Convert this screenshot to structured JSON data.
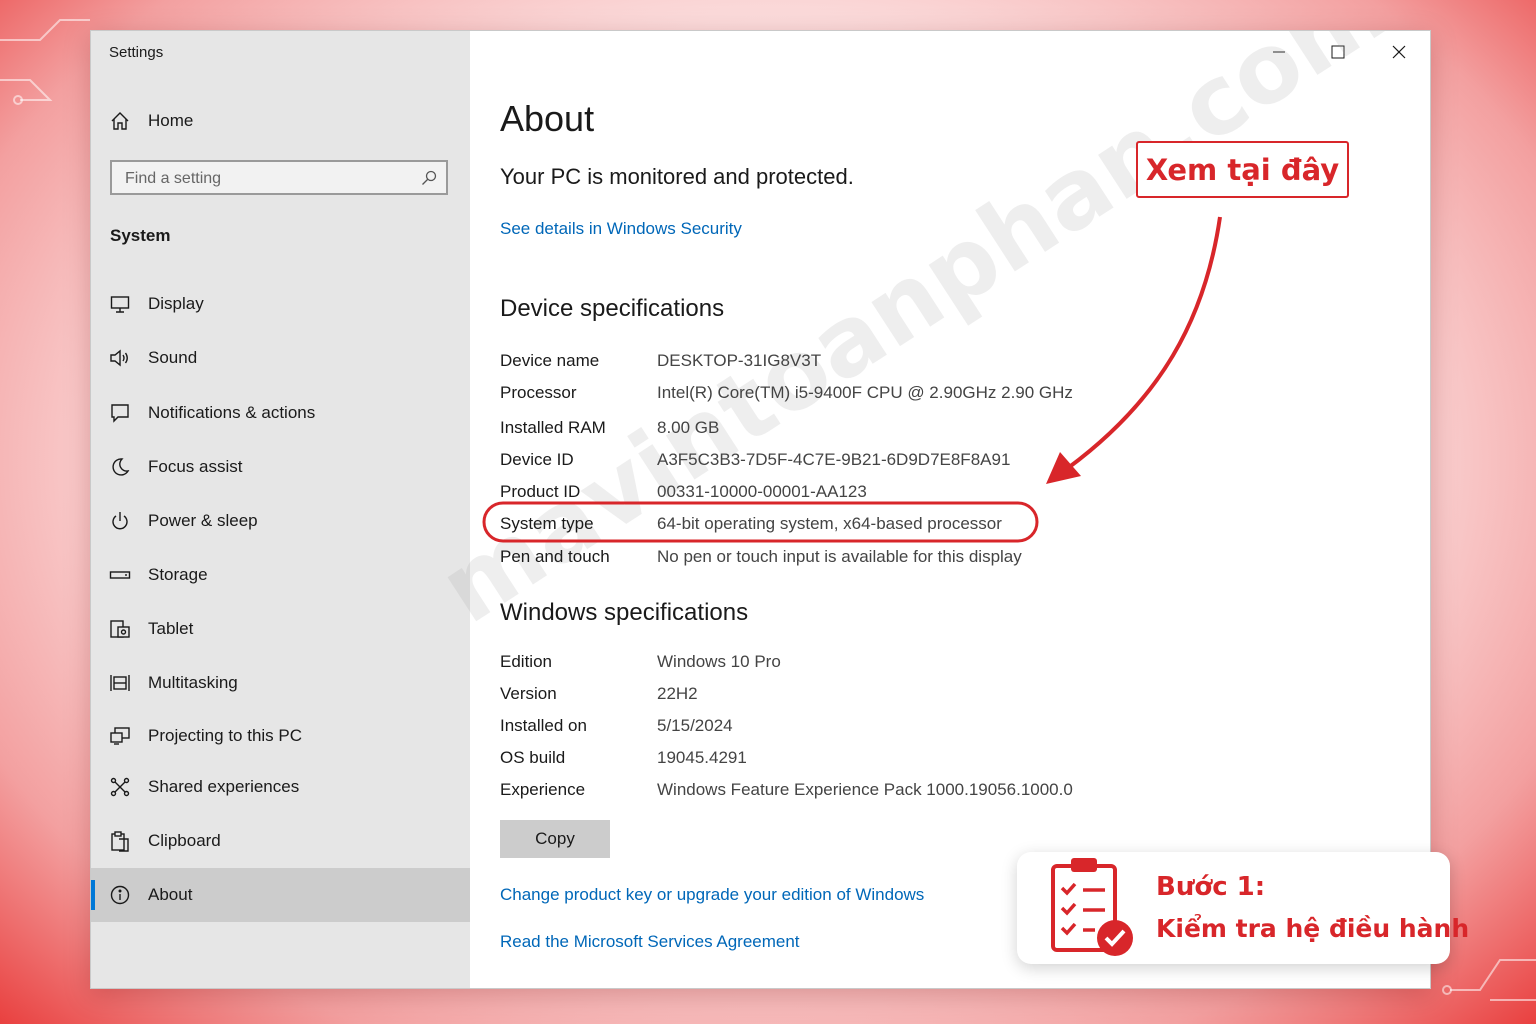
{
  "window": {
    "title": "Settings",
    "controls": [
      "minimize",
      "maximize",
      "close"
    ]
  },
  "sidebar": {
    "home_label": "Home",
    "search_placeholder": "Find a setting",
    "section": "System",
    "items": [
      {
        "label": "Display",
        "icon": "monitor-icon"
      },
      {
        "label": "Sound",
        "icon": "speaker-icon"
      },
      {
        "label": "Notifications & actions",
        "icon": "message-icon"
      },
      {
        "label": "Focus assist",
        "icon": "moon-icon"
      },
      {
        "label": "Power & sleep",
        "icon": "power-icon"
      },
      {
        "label": "Storage",
        "icon": "drive-icon"
      },
      {
        "label": "Tablet",
        "icon": "tablet-icon"
      },
      {
        "label": "Multitasking",
        "icon": "multitasking-icon"
      },
      {
        "label": "Projecting to this PC",
        "icon": "projecting-icon"
      },
      {
        "label": "Shared experiences",
        "icon": "shared-icon"
      },
      {
        "label": "Clipboard",
        "icon": "clipboard-icon"
      },
      {
        "label": "About",
        "icon": "info-icon",
        "active": true
      }
    ]
  },
  "main": {
    "title": "About",
    "protection": "Your PC is monitored and protected.",
    "security_link": "See details in Windows Security",
    "device_heading": "Device specifications",
    "device_specs": [
      {
        "label": "Device name",
        "value": "DESKTOP-31IG8V3T"
      },
      {
        "label": "Processor",
        "value": "Intel(R) Core(TM) i5-9400F CPU @ 2.90GHz   2.90 GHz"
      },
      {
        "label": "Installed RAM",
        "value": "8.00 GB"
      },
      {
        "label": "Device ID",
        "value": "A3F5C3B3-7D5F-4C7E-9B21-6D9D7E8F8A91"
      },
      {
        "label": "Product ID",
        "value": "00331-10000-00001-AA123"
      },
      {
        "label": "System type",
        "value": "64-bit operating system, x64-based processor"
      },
      {
        "label": "Pen and touch",
        "value": "No pen or touch input is available for this display"
      }
    ],
    "windows_heading": "Windows specifications",
    "windows_specs": [
      {
        "label": "Edition",
        "value": "Windows 10 Pro"
      },
      {
        "label": "Version",
        "value": "22H2"
      },
      {
        "label": "Installed on",
        "value": "5/15/2024"
      },
      {
        "label": "OS build",
        "value": "19045.4291"
      },
      {
        "label": "Experience",
        "value": "Windows Feature Experience Pack 1000.19056.1000.0"
      }
    ],
    "copy_button": "Copy",
    "link_product_key": "Change product key or upgrade your edition of Windows",
    "link_services": "Read the Microsoft Services Agreement"
  },
  "annotations": {
    "callout": "Xem tại đây",
    "step_title": "Bước 1:",
    "step_desc": "Kiểm tra hệ điều hành",
    "watermark": "mavintoanphan.com",
    "accent": "#d8262a"
  },
  "colors": {
    "sidebar_bg": "#e6e6e6",
    "link": "#0067b8",
    "selection": "#0078d7"
  }
}
